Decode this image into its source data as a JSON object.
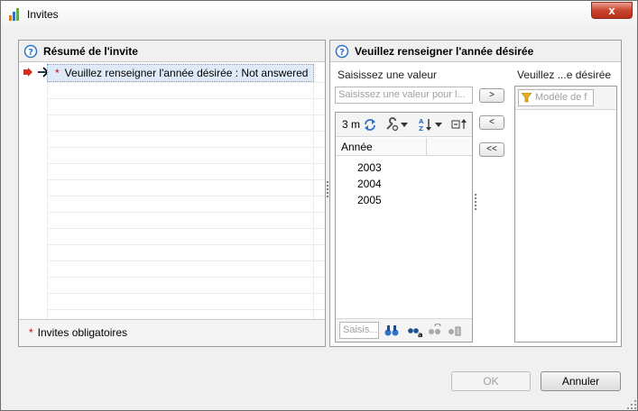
{
  "window": {
    "title": "Invites",
    "close_label": "x"
  },
  "summary_panel": {
    "title": "Résumé de l'invite",
    "prompt_item": {
      "required_mark": "*",
      "label": "Veuillez renseigner l'année désirée : Not answered"
    },
    "footer": {
      "required_mark": "*",
      "label": "Invites obligatoires"
    }
  },
  "prompt_panel": {
    "title": "Veuillez renseigner l'année désirée",
    "enter_value_label": "Saisissez une valeur",
    "enter_value_placeholder": "Saisissez une valeur pour l...",
    "selected_label": "Veuillez ...e désirée",
    "selected_filter_placeholder": "Modèle de f",
    "toolbar": {
      "refresh_text": "3 m"
    },
    "column_header": "Année",
    "values": [
      "2003",
      "2004",
      "2005"
    ],
    "search_placeholder": "Saisis...",
    "move_buttons": {
      "add": ">",
      "remove": "<",
      "remove_all": "<<"
    }
  },
  "buttons": {
    "ok": "OK",
    "cancel": "Annuler"
  }
}
